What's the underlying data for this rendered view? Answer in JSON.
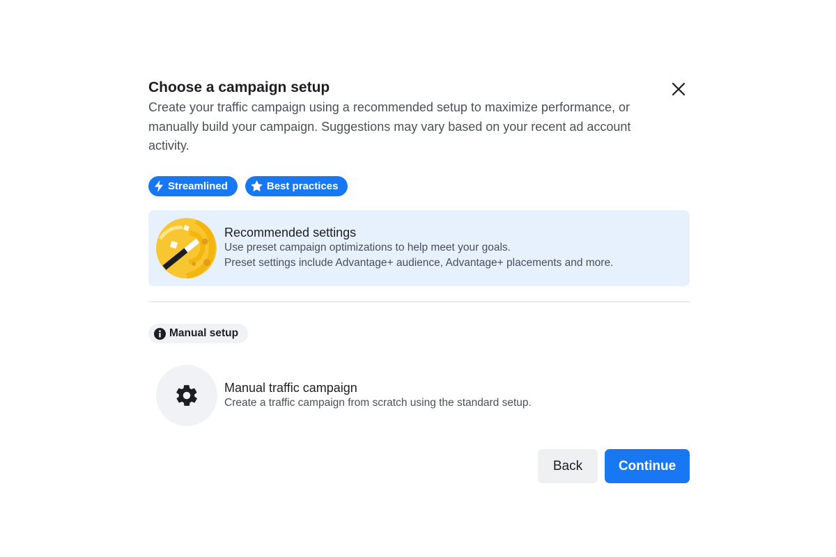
{
  "dialog": {
    "title": "Choose a campaign setup",
    "description": "Create your traffic campaign using a recommended setup to maximize performance, or manually build your campaign. Suggestions may vary based on your recent ad account activity.",
    "close_icon": "close-icon"
  },
  "badges": [
    {
      "label": "Streamlined",
      "icon": "lightning-icon"
    },
    {
      "label": "Best practices",
      "icon": "star-icon"
    }
  ],
  "recommended": {
    "title": "Recommended settings",
    "line1": "Use preset campaign optimizations to help meet your goals.",
    "line2": "Preset settings include Advantage+ audience, Advantage+ placements and more.",
    "icon": "magic-wand-icon"
  },
  "manual_section": {
    "label": "Manual setup",
    "icon": "info-icon"
  },
  "manual": {
    "title": "Manual traffic campaign",
    "subtitle": "Create a traffic campaign from scratch using the standard setup.",
    "icon": "gear-icon"
  },
  "footer": {
    "back_label": "Back",
    "continue_label": "Continue"
  },
  "colors": {
    "accent": "#1877f2",
    "recommended_bg": "#e7f0fd",
    "neutral_bg": "#f0f2f5"
  }
}
